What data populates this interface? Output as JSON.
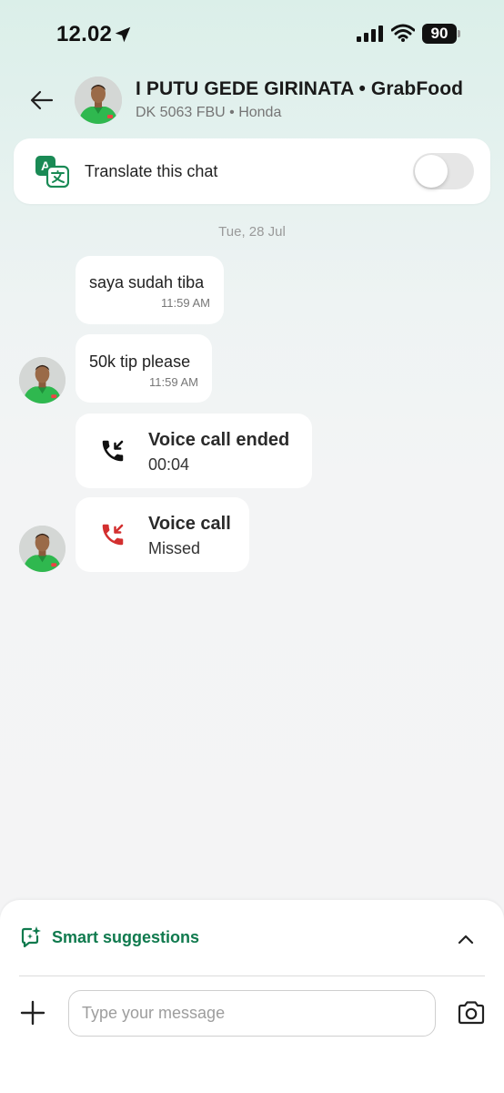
{
  "status_bar": {
    "time": "12.02",
    "battery": "90",
    "icons": [
      "location-arrow-icon",
      "signal-icon",
      "wifi-icon",
      "battery-icon"
    ]
  },
  "header": {
    "driver_name": "I PUTU GEDE GIRINATA • GrabFood",
    "vehicle": "DK 5063 FBU • Honda",
    "icons": [
      "back-arrow-icon",
      "driver-avatar"
    ]
  },
  "translate": {
    "label": "Translate this chat",
    "enabled": false,
    "icon": "translate-icon"
  },
  "chat": {
    "date": "Tue, 28 Jul",
    "messages": [
      {
        "type": "text",
        "text": "saya sudah tiba",
        "time": "11:59 AM"
      },
      {
        "type": "text",
        "text": "50k tip please",
        "time": "11:59 AM"
      },
      {
        "type": "call",
        "title": "Voice call ended",
        "detail": "00:04",
        "icon": "call-incoming-icon"
      },
      {
        "type": "call",
        "title": "Voice call",
        "detail": "Missed",
        "icon": "call-missed-icon"
      }
    ]
  },
  "bottom": {
    "smart_suggestions": "Smart suggestions",
    "input_placeholder": "Type your message",
    "icons": [
      "sparkle-chat-icon",
      "chevron-up-icon",
      "plus-icon",
      "camera-icon"
    ]
  },
  "colors": {
    "accent_green": "#107a4e",
    "missed_red": "#d32f2f",
    "toggle_off": "#e6e6e6"
  }
}
